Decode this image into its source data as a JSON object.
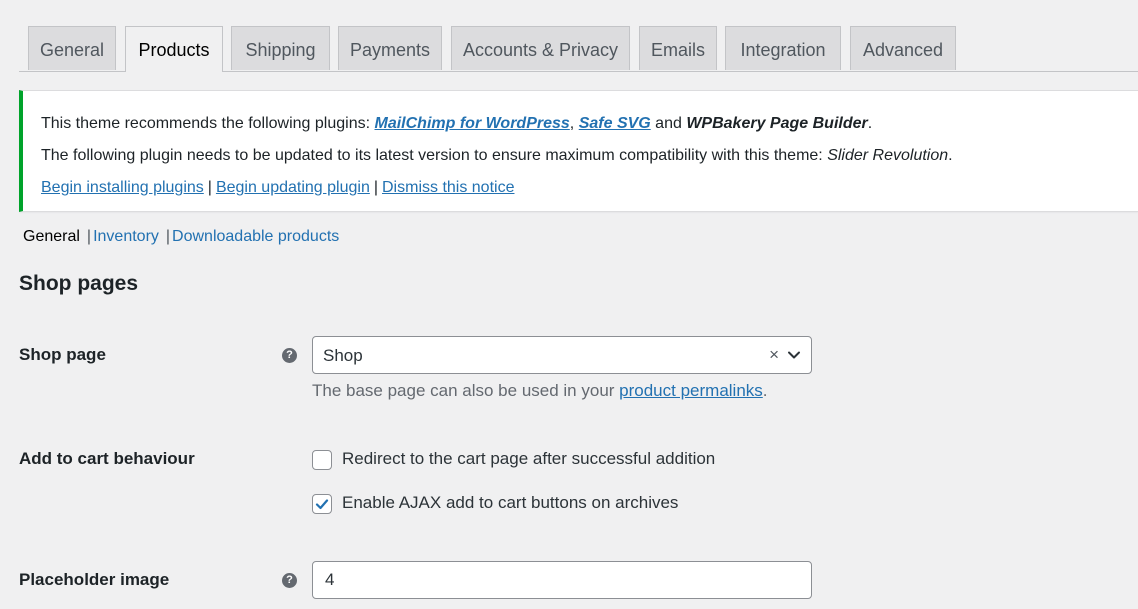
{
  "tabs": [
    {
      "label": "General"
    },
    {
      "label": "Products",
      "active": true
    },
    {
      "label": "Shipping"
    },
    {
      "label": "Payments"
    },
    {
      "label": "Accounts & Privacy"
    },
    {
      "label": "Emails"
    },
    {
      "label": "Integration"
    },
    {
      "label": "Advanced"
    }
  ],
  "notice": {
    "accent_color": "#00a32a",
    "line1_prefix": "This theme recommends the following plugins: ",
    "plugin1": "MailChimp for WordPress",
    "comma": ",",
    "plugin2": "Safe SVG",
    "and": " and ",
    "plugin3": "WPBakery Page Builder",
    "period": ".",
    "line2_prefix": "The following plugin needs to be updated to its latest version to ensure maximum compatibility with this theme: ",
    "plugin4": "Slider Revolution",
    "action_install": "Begin installing plugins",
    "action_update": "Begin updating plugin",
    "action_dismiss": "Dismiss this notice",
    "separator": "|"
  },
  "subnav": {
    "items": [
      {
        "label": "General",
        "current": true
      },
      {
        "label": "Inventory"
      },
      {
        "label": "Downloadable products"
      }
    ],
    "separator": "|"
  },
  "section": {
    "title": "Shop pages"
  },
  "fields": {
    "shop_page": {
      "label": "Shop page",
      "help_icon": "question-icon",
      "value": "Shop",
      "clear": "×",
      "description_prefix": "The base page can also be used in your ",
      "description_link": "product permalinks",
      "description_suffix": "."
    },
    "add_to_cart": {
      "label": "Add to cart behaviour",
      "option1": {
        "label": "Redirect to the cart page after successful addition",
        "checked": false
      },
      "option2": {
        "label": "Enable AJAX add to cart buttons on archives",
        "checked": true
      }
    },
    "placeholder_image": {
      "label": "Placeholder image",
      "help_icon": "question-icon",
      "value": "4"
    }
  },
  "colors": {
    "link": "#2271b1",
    "background": "#f0f0f1"
  }
}
